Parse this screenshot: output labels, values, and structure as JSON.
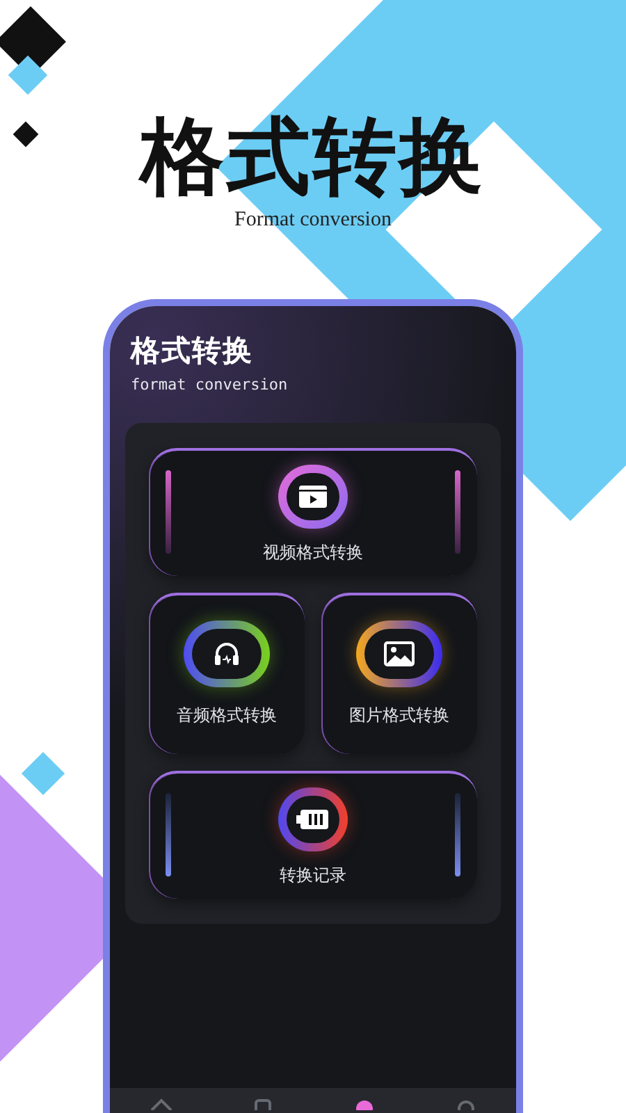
{
  "headline": {
    "title": "格式转换",
    "subtitle": "Format conversion"
  },
  "app": {
    "title": "格式转换",
    "subtitle": "format conversion",
    "features": [
      {
        "kind": "wide",
        "label": "视频格式转换"
      },
      {
        "kind": "square",
        "label": "音频格式转换"
      },
      {
        "kind": "square",
        "label": "图片格式转换"
      },
      {
        "kind": "wide",
        "label": "转换记录"
      }
    ],
    "nav": [
      {
        "selected": false
      },
      {
        "selected": false
      },
      {
        "selected": true
      },
      {
        "selected": false
      }
    ]
  }
}
